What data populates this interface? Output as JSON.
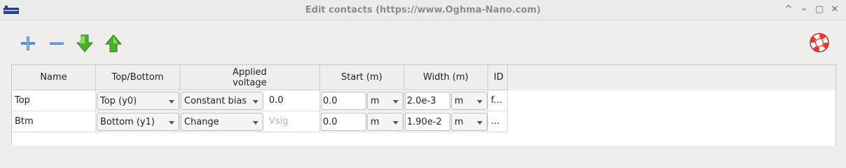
{
  "window": {
    "title": "Edit contacts (https://www.Oghma-Nano.com)",
    "controls": [
      "^",
      "⌄",
      "▢",
      "✕"
    ]
  },
  "toolbar": {
    "add": "plus-icon",
    "remove": "minus-icon",
    "down": "arrow-down-icon",
    "up": "arrow-up-icon",
    "help": "lifebuoy-icon"
  },
  "table": {
    "columns": [
      "Name",
      "Top/Bottom",
      "Applied\nvoltage",
      "Start (m)",
      "Width (m)",
      "ID"
    ],
    "rows": [
      {
        "name": "Top",
        "position": "Top (y0)",
        "voltage_type": "Constant bias",
        "voltage_value": "0.0",
        "voltage_placeholder": "",
        "start": "0.0",
        "start_unit": "m",
        "width": "2.0e-3",
        "width_unit": "m",
        "id": "f..."
      },
      {
        "name": "Btm",
        "position": "Bottom (y1)",
        "voltage_type": "Change",
        "voltage_value": "",
        "voltage_placeholder": "Vsig",
        "start": "0.0",
        "start_unit": "m",
        "width": "1.90e-2",
        "width_unit": "m",
        "id": "..."
      }
    ]
  },
  "colors": {
    "accent": "#2e7d32",
    "plus": "#4a7fb5",
    "help": "#d32f2f"
  }
}
